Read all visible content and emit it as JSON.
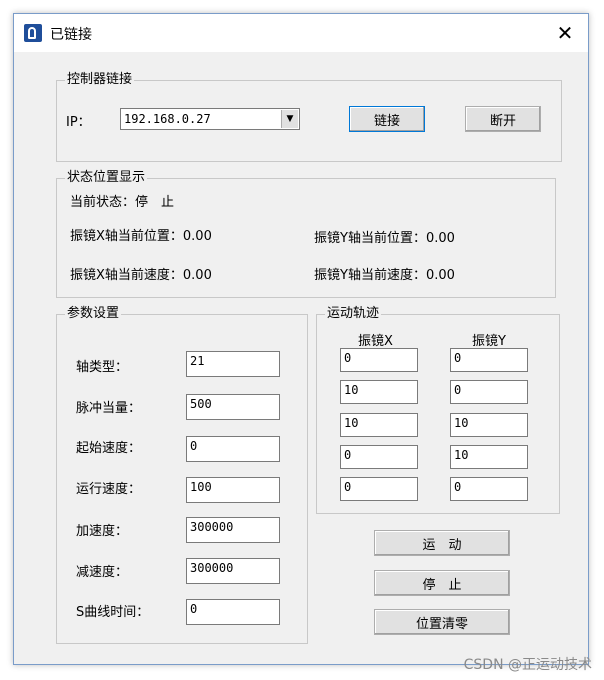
{
  "window": {
    "title": "已链接",
    "close_glyph": "✕"
  },
  "controller": {
    "group_title": "控制器链接",
    "ip_label": "IP：",
    "ip_value": "192.168.0.27",
    "connect_label": "链接",
    "disconnect_label": "断开"
  },
  "status": {
    "group_title": "状态位置显示",
    "current_state": "当前状态：停　止",
    "x_pos": "振镜X轴当前位置：0.00",
    "y_pos": "振镜Y轴当前位置：0.00",
    "x_speed": "振镜X轴当前速度：0.00",
    "y_speed": "振镜Y轴当前速度：0.00"
  },
  "params": {
    "group_title": "参数设置",
    "rows": [
      {
        "label": "轴类型：",
        "value": "21"
      },
      {
        "label": "脉冲当量：",
        "value": "500"
      },
      {
        "label": "起始速度：",
        "value": "0"
      },
      {
        "label": "运行速度：",
        "value": "100"
      },
      {
        "label": "加速度：",
        "value": "300000"
      },
      {
        "label": "减速度：",
        "value": "300000"
      },
      {
        "label": "S曲线时间：",
        "value": "0"
      }
    ]
  },
  "trajectory": {
    "group_title": "运动轨迹",
    "col_x": "振镜X",
    "col_y": "振镜Y",
    "rows": [
      {
        "x": "0",
        "y": "0"
      },
      {
        "x": "10",
        "y": "0"
      },
      {
        "x": "10",
        "y": "10"
      },
      {
        "x": "0",
        "y": "10"
      },
      {
        "x": "0",
        "y": "0"
      }
    ]
  },
  "actions": {
    "move_label": "运　动",
    "stop_label": "停　止",
    "zero_label": "位置清零"
  },
  "watermark": "CSDN @正运动技术"
}
